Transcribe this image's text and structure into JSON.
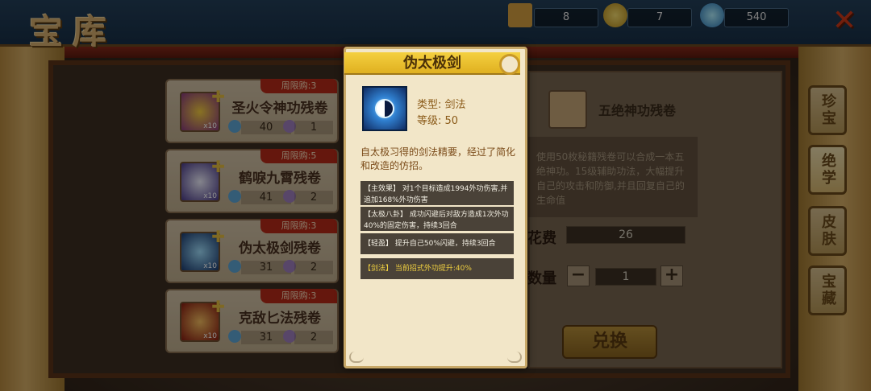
{
  "page": {
    "title": "宝库",
    "close_icon": "close-x-icon"
  },
  "resources": [
    {
      "icon": "scroll-icon",
      "value": "8"
    },
    {
      "icon": "gold-coin-icon",
      "value": "7"
    },
    {
      "icon": "blue-gem-icon",
      "value": "540"
    }
  ],
  "items": [
    {
      "name": "圣火令神功残卷",
      "badge": "周限购:3",
      "count": "x10",
      "cost_a": "40",
      "cost_b": "1"
    },
    {
      "name": "鹤唳九霄残卷",
      "badge": "周限购:5",
      "count": "x10",
      "cost_a": "41",
      "cost_b": "2"
    },
    {
      "name": "伪太极剑残卷",
      "badge": "周限购:3",
      "count": "x10",
      "cost_a": "31",
      "cost_b": "2"
    },
    {
      "name": "克敌匕法残卷",
      "badge": "周限购:3",
      "count": "x10",
      "cost_a": "31",
      "cost_b": "2"
    }
  ],
  "detail": {
    "name": "五绝神功残卷",
    "description": "使用50枚秘籍残卷可以合成一本五绝神功。15级辅助功法，大幅提升自己的攻击和防御,并且回复自己的生命值",
    "cost_label": "花费",
    "cost_value": "26",
    "qty_label": "数量",
    "qty_value": "1",
    "minus": "−",
    "plus": "+",
    "redeem_button": "兑换"
  },
  "side_tabs": [
    "珍宝",
    "绝学",
    "皮肤",
    "宝藏"
  ],
  "popup": {
    "title": "伪太极剑",
    "type_label": "类型: 剑法",
    "level_label": "等级: 50",
    "flavor": "自太极习得的剑法精要，经过了简化和改造的仿招。",
    "effects": [
      {
        "text": "【主效果】 对1个目标造成1994外功伤害,并追加168%外功伤害",
        "highlight": false
      },
      {
        "text": "【太极八卦】 成功闪避后对敌方造成1次外功40%的固定伤害，持续3回合",
        "highlight": false
      },
      {
        "text": "【轻盈】 提升自己50%闪避，持续3回合",
        "highlight": false
      },
      {
        "text": "【剑法】 当前招式外功提升:40%",
        "highlight": true
      }
    ]
  }
}
